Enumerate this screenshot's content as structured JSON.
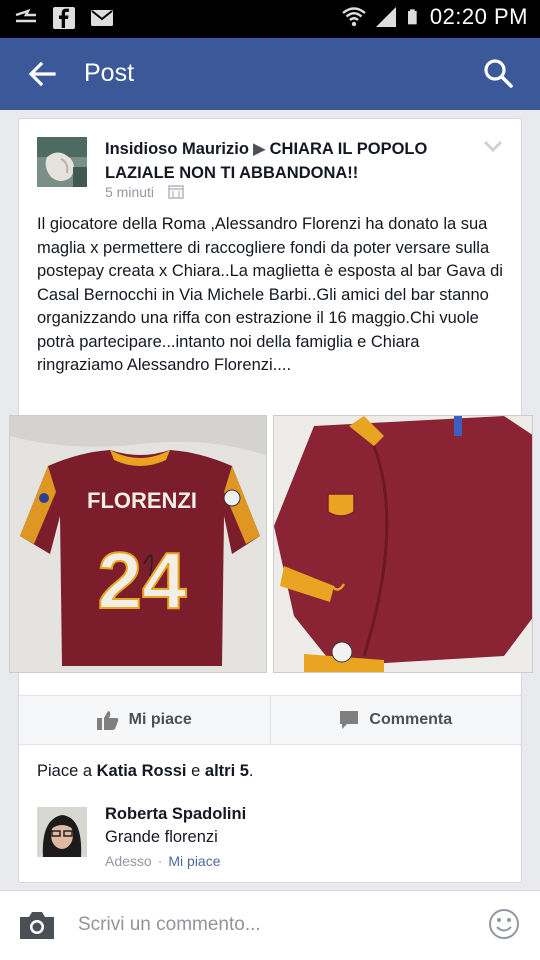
{
  "status": {
    "time": "02:20 PM",
    "icons": [
      "notification-icon",
      "facebook-icon",
      "mail-icon",
      "wifi-icon",
      "signal-icon",
      "battery-icon"
    ]
  },
  "appbar": {
    "title": "Post",
    "color": "#3b5998"
  },
  "post": {
    "author": "Insidioso Maurizio",
    "target": "CHIARA IL POPOLO LAZIALE NON TI ABBANDONA!!",
    "time": "5 minuti",
    "text": "Il giocatore della Roma ,Alessandro Florenzi  ha donato la sua maglia x permettere di raccogliere fondi da poter versare sulla postepay creata x Chiara..La maglietta è esposta al bar Gava di Casal Bernocchi in Via Michele Barbi..Gli amici del bar stanno organizzando una riffa con estrazione il 16 maggio.Chi vuole potrà partecipare...intanto noi della famiglia e Chiara ringraziamo Alessandro Florenzi....",
    "photo1": {
      "name": "FLORENZI",
      "number": "24"
    }
  },
  "actions": {
    "like": "Mi piace",
    "comment": "Commenta"
  },
  "likes": {
    "prefix": "Piace a",
    "name": "Katia Rossi",
    "mid": "e",
    "others": "altri 5",
    "suffix": "."
  },
  "comment": {
    "author": "Roberta Spadolini",
    "text": "Grande florenzi",
    "time": "Adesso",
    "sep": "·",
    "like": "Mi piace"
  },
  "composer": {
    "placeholder": "Scrivi un commento..."
  }
}
